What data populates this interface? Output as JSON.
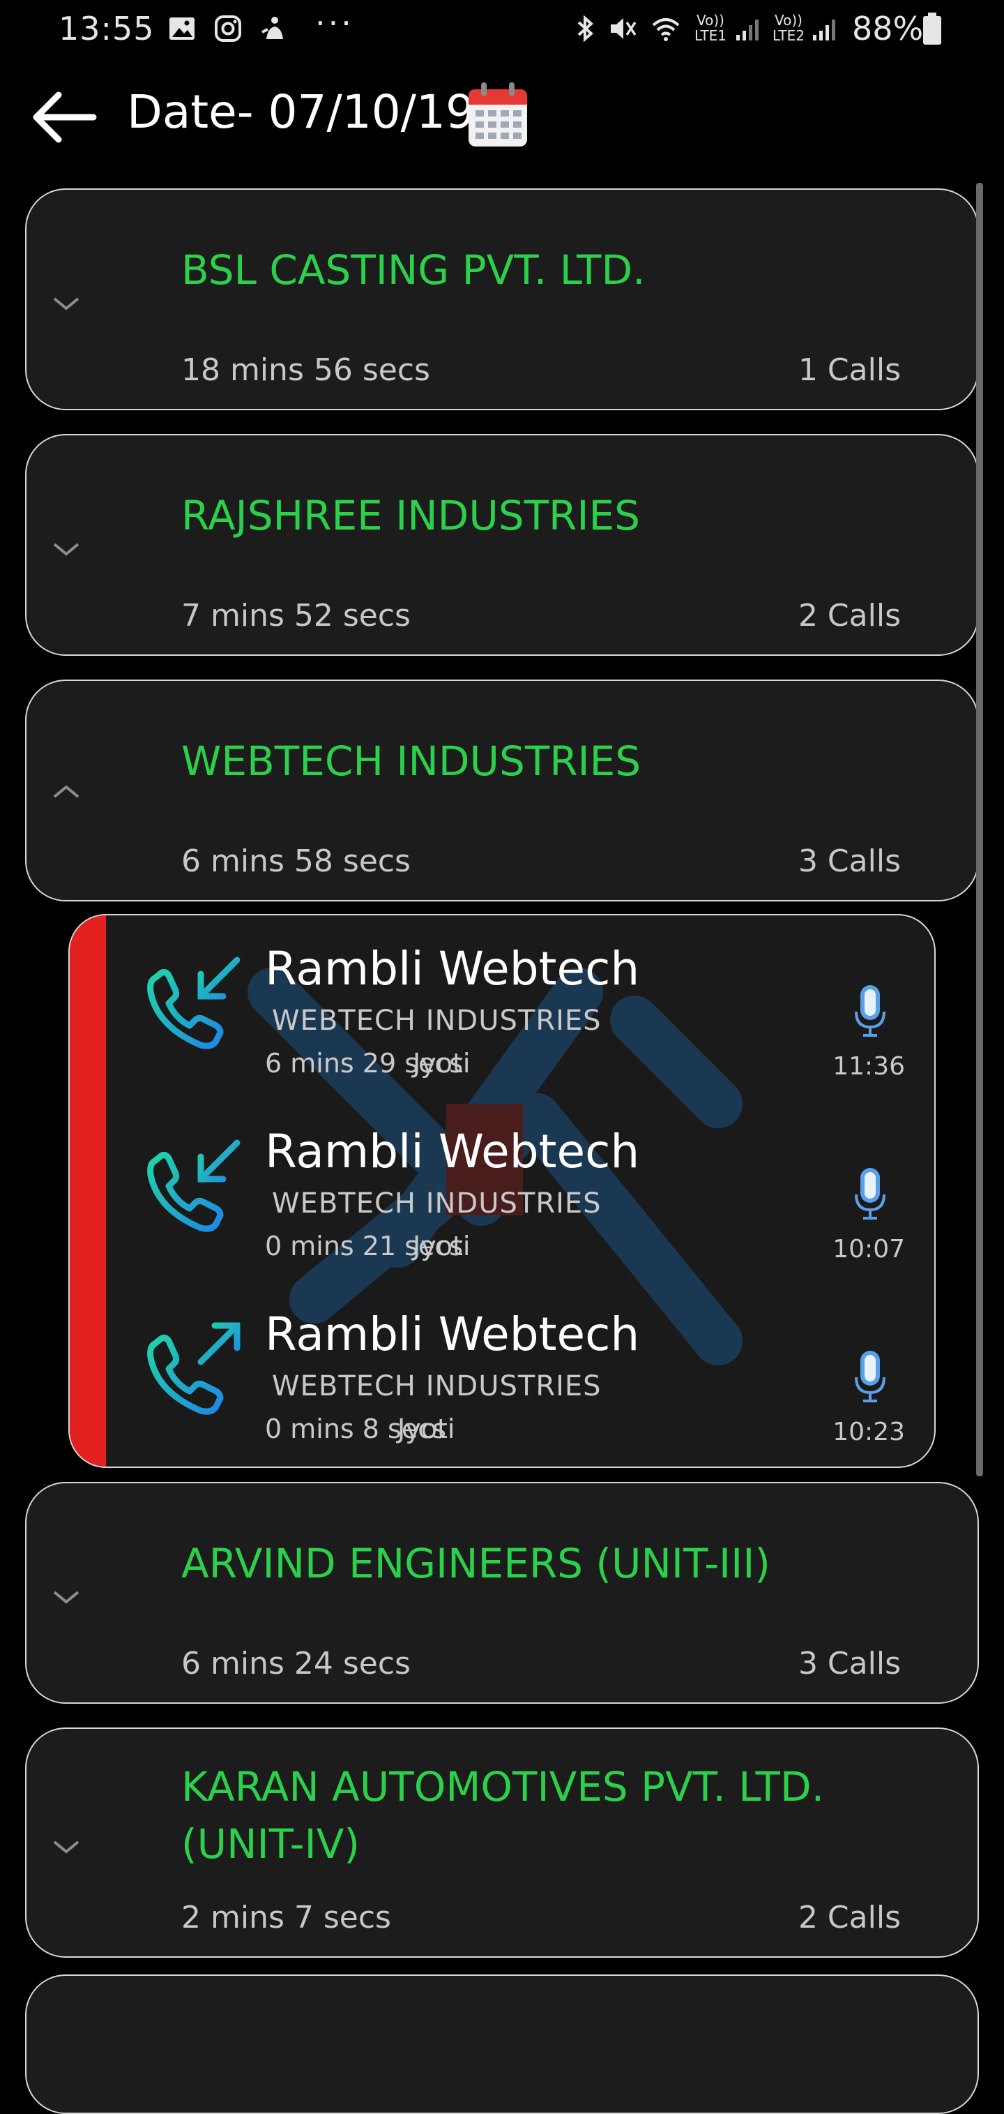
{
  "status_bar": {
    "time": "13:55",
    "icons_left": [
      "gallery-icon",
      "instagram-icon",
      "notification-icon"
    ],
    "more": "···",
    "lte1_label": "Vo)) LTE1",
    "lte2_label": "Vo)) LTE2",
    "battery": "88%"
  },
  "header": {
    "title": "Date- 07/10/19"
  },
  "colors": {
    "accent_green": "#2bd14a",
    "card_bg": "#1c1c1c",
    "indicator_red": "#e32020"
  },
  "groups": [
    {
      "name": "BSL CASTING PVT. LTD.",
      "duration": "18 mins 56 secs",
      "calls": "1 Calls",
      "expanded": false
    },
    {
      "name": "RAJSHREE INDUSTRIES",
      "duration": "7 mins 52 secs",
      "calls": "2 Calls",
      "expanded": false
    },
    {
      "name": "WEBTECH INDUSTRIES",
      "duration": "6 mins 58 secs",
      "calls": "3 Calls",
      "expanded": true
    },
    {
      "name": "ARVIND ENGINEERS (UNIT-III)",
      "duration": "6 mins 24 secs",
      "calls": "3 Calls",
      "expanded": false
    },
    {
      "name": "KARAN AUTOMOTIVES PVT. LTD. (UNIT-IV)",
      "duration": "2 mins 7 secs",
      "calls": "2 Calls",
      "expanded": false
    },
    {
      "name": "",
      "duration": "",
      "calls": "",
      "expanded": false
    }
  ],
  "webtech_calls": [
    {
      "contact": "Rambli Webtech",
      "company": "WEBTECH INDUSTRIES",
      "duration": "6 mins 29 secs",
      "user": "Jyoti",
      "time": "11:36",
      "direction": "incoming"
    },
    {
      "contact": "Rambli Webtech",
      "company": "WEBTECH INDUSTRIES",
      "duration": "0 mins 21 secs",
      "user": "Jyoti",
      "time": "10:07",
      "direction": "incoming"
    },
    {
      "contact": "Rambli Webtech",
      "company": "WEBTECH INDUSTRIES",
      "duration": "0 mins 8 secs",
      "user": "Jyoti",
      "time": "10:23",
      "direction": "outgoing"
    }
  ]
}
